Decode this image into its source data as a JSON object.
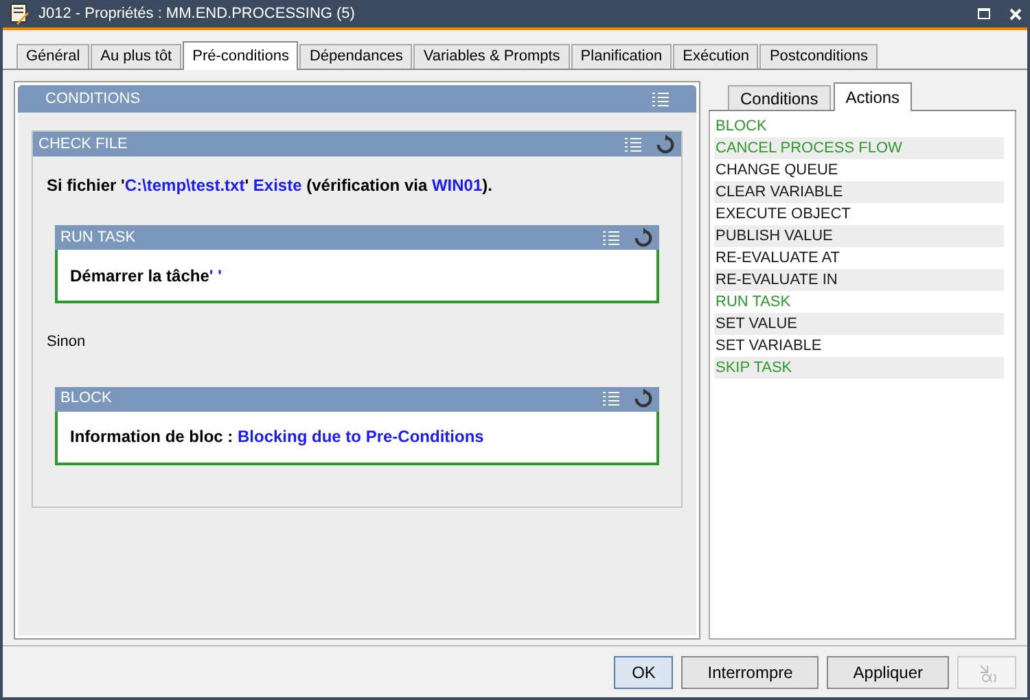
{
  "window": {
    "title": "J012 - Propriétés : MM.END.PROCESSING (5)"
  },
  "tabs": [
    {
      "label": "Général",
      "selected": false
    },
    {
      "label": "Au plus tôt",
      "selected": false
    },
    {
      "label": "Pré-conditions",
      "selected": true
    },
    {
      "label": "Dépendances",
      "selected": false
    },
    {
      "label": "Variables & Prompts",
      "selected": false
    },
    {
      "label": "Planification",
      "selected": false
    },
    {
      "label": "Exécution",
      "selected": false
    },
    {
      "label": "Postconditions",
      "selected": false
    }
  ],
  "conditions": {
    "title": "CONDITIONS",
    "check": {
      "title": "CHECK FILE",
      "parts": [
        {
          "text": "Si fichier '",
          "highlight": false
        },
        {
          "text": "C:\\temp\\test.txt",
          "highlight": true
        },
        {
          "text": "' ",
          "highlight": false
        },
        {
          "text": "Existe",
          "highlight": true
        },
        {
          "text": " (vérification via ",
          "highlight": false
        },
        {
          "text": "WIN01",
          "highlight": true
        },
        {
          "text": ").",
          "highlight": false
        }
      ],
      "then": {
        "title": "RUN TASK",
        "parts": [
          {
            "text": "Démarrer la tâche",
            "highlight": false
          },
          {
            "text": "' '",
            "highlight": true
          }
        ]
      }
    },
    "else_label": "Sinon",
    "else": {
      "title": "BLOCK",
      "parts": [
        {
          "text": "Information de bloc : ",
          "highlight": false
        },
        {
          "text": "Blocking due to Pre-Conditions",
          "highlight": true
        }
      ]
    }
  },
  "side_tabs": [
    {
      "label": "Conditions",
      "selected": false
    },
    {
      "label": "Actions",
      "selected": true
    }
  ],
  "actions": [
    {
      "label": "BLOCK",
      "color": "#2b9a2b"
    },
    {
      "label": "CANCEL PROCESS FLOW",
      "color": "#2b9a2b"
    },
    {
      "label": "CHANGE QUEUE",
      "color": "#1a1a1a"
    },
    {
      "label": "CLEAR VARIABLE",
      "color": "#1a1a1a"
    },
    {
      "label": "EXECUTE OBJECT",
      "color": "#1a1a1a"
    },
    {
      "label": "PUBLISH VALUE",
      "color": "#1a1a1a"
    },
    {
      "label": "RE-EVALUATE AT",
      "color": "#1a1a1a"
    },
    {
      "label": "RE-EVALUATE IN",
      "color": "#1a1a1a"
    },
    {
      "label": "RUN TASK",
      "color": "#2b9a2b"
    },
    {
      "label": "SET VALUE",
      "color": "#1a1a1a"
    },
    {
      "label": "SET VARIABLE",
      "color": "#1a1a1a"
    },
    {
      "label": "SKIP TASK",
      "color": "#2b9a2b"
    }
  ],
  "buttons": [
    {
      "label": "OK",
      "kind": "default"
    },
    {
      "label": "Interrompre",
      "kind": "normal"
    },
    {
      "label": "Appliquer",
      "kind": "normal"
    },
    {
      "kind": "icon",
      "disabled": true
    }
  ]
}
